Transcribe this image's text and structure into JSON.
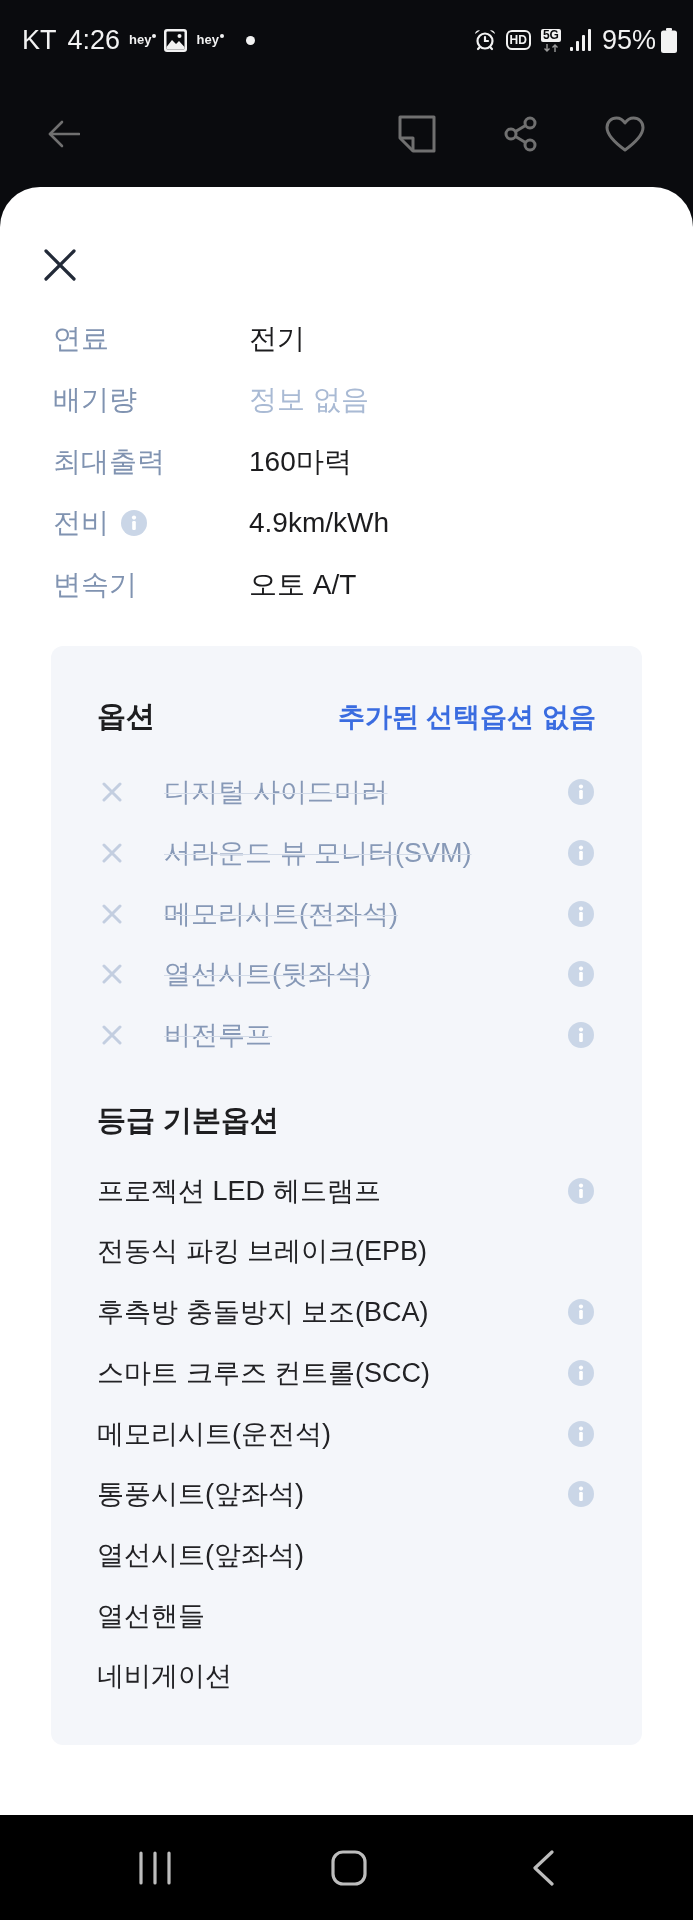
{
  "status_bar": {
    "carrier": "KT",
    "time": "4:26",
    "notifications": [
      {
        "kind": "app",
        "label": "hey"
      },
      {
        "kind": "gallery"
      },
      {
        "kind": "app",
        "label": "hey"
      },
      {
        "kind": "dot"
      }
    ],
    "indicators": [
      {
        "kind": "alarm"
      },
      {
        "kind": "hd",
        "label": "HD"
      },
      {
        "kind": "network",
        "label": "5G"
      },
      {
        "kind": "signal"
      }
    ],
    "battery": "95%"
  },
  "specs": [
    {
      "label": "연료",
      "value": "전기",
      "available": true,
      "info": false
    },
    {
      "label": "배기량",
      "value": "정보 없음",
      "available": false,
      "info": false
    },
    {
      "label": "최대출력",
      "value": "160마력",
      "available": true,
      "info": false
    },
    {
      "label": "전비",
      "value": "4.9km/kWh",
      "available": true,
      "info": true
    },
    {
      "label": "변속기",
      "value": "오토 A/T",
      "available": true,
      "info": false
    }
  ],
  "options": {
    "title": "옵션",
    "summary": "추가된 선택옵션 없음",
    "items": [
      {
        "name": "디지털 사이드미러",
        "included": false,
        "info": true
      },
      {
        "name": "서라운드 뷰 모니터(SVM)",
        "included": false,
        "info": true
      },
      {
        "name": "메모리시트(전좌석)",
        "included": false,
        "info": true
      },
      {
        "name": "열선시트(뒷좌석)",
        "included": false,
        "info": true
      },
      {
        "name": "비전루프",
        "included": false,
        "info": true
      }
    ]
  },
  "basic_options": {
    "title": "등급 기본옵션",
    "items": [
      {
        "name": "프로젝션 LED 헤드램프",
        "included": true,
        "info": true
      },
      {
        "name": "전동식 파킹 브레이크(EPB)",
        "included": true,
        "info": false
      },
      {
        "name": "후측방 충돌방지 보조(BCA)",
        "included": true,
        "info": true
      },
      {
        "name": "스마트 크루즈 컨트롤(SCC)",
        "included": true,
        "info": true
      },
      {
        "name": "메모리시트(운전석)",
        "included": true,
        "info": true
      },
      {
        "name": "통풍시트(앞좌석)",
        "included": true,
        "info": true
      },
      {
        "name": "열선시트(앞좌석)",
        "included": true,
        "info": false
      },
      {
        "name": "열선핸들",
        "included": true,
        "info": false
      },
      {
        "name": "네비게이션",
        "included": true,
        "info": false
      }
    ]
  }
}
